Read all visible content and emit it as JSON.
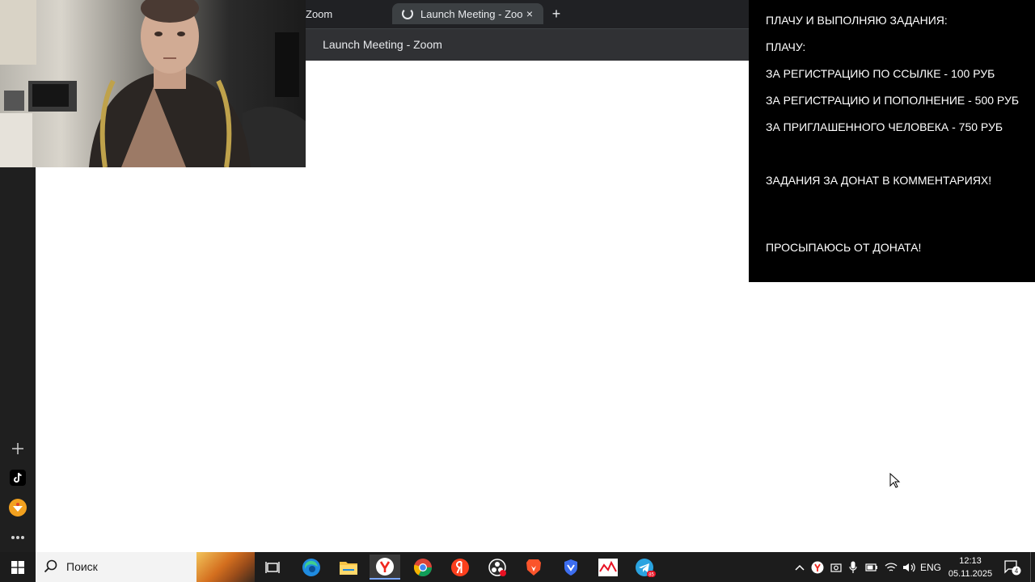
{
  "browser": {
    "partial_tab_label": "Zoom",
    "active_tab_title": "Launch Meeting - Zoom",
    "close_glyph": "×",
    "new_tab_glyph": "+",
    "page_title": "Launch Meeting - Zoom"
  },
  "sidebar": {
    "items": [
      {
        "icon": "plus-icon"
      },
      {
        "icon": "tiktok-icon"
      },
      {
        "icon": "app-icon"
      },
      {
        "icon": "more-icon"
      }
    ]
  },
  "overlay": {
    "lines": [
      "ПЛАЧУ И ВЫПОЛНЯЮ ЗАДАНИЯ:",
      "ПЛАЧУ:",
      " ЗА РЕГИСТРАЦИЮ ПО ССЫЛКЕ - 100 РУБ",
      "ЗА РЕГИСТРАЦИЮ И ПОПОЛНЕНИЕ - 500 РУБ",
      "ЗА ПРИГЛАШЕННОГО ЧЕЛОВЕКА - 750 РУБ",
      "ЗАДАНИЯ ЗА ДОНАТ В КОММЕНТАРИЯХ!",
      "ПРОСЫПАЮСЬ ОТ ДОНАТА!"
    ]
  },
  "taskbar": {
    "search_label": "Поиск",
    "apps": [
      {
        "icon": "task-view-icon"
      },
      {
        "icon": "edge-icon"
      },
      {
        "icon": "file-explorer-icon"
      },
      {
        "icon": "yandex-browser-icon"
      },
      {
        "icon": "chrome-icon"
      },
      {
        "icon": "yandex-icon"
      },
      {
        "icon": "obs-icon"
      },
      {
        "icon": "brave-icon"
      },
      {
        "icon": "shield-app-icon"
      },
      {
        "icon": "chart-app-icon"
      },
      {
        "icon": "telegram-icon",
        "badge": "85"
      }
    ],
    "tray": {
      "language": "ENG",
      "time": "12:13",
      "date": "05.11.2025",
      "notification_count": "4"
    }
  },
  "colors": {
    "taskbar": "#1c1c1c",
    "tab_strip": "#202124",
    "overlay_bg": "#000000",
    "accent": "#7aa6ff"
  }
}
